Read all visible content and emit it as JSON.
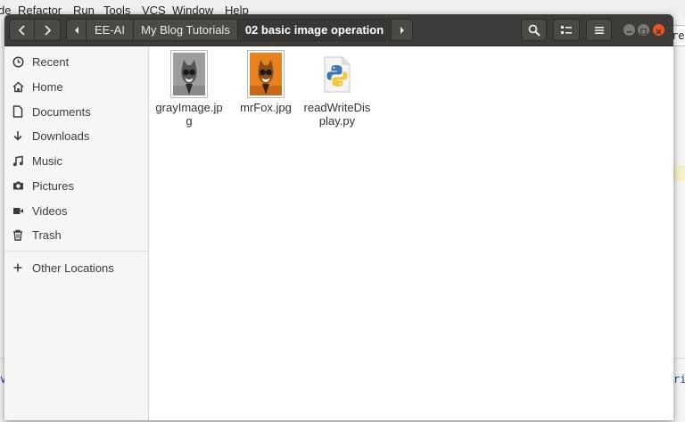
{
  "ide": {
    "menu": [
      "de",
      "Refactor",
      "Run",
      "Tools",
      "VCS",
      "Window",
      "Help"
    ],
    "right_field_text": "rea",
    "fragment_left": "v",
    "fragment_right": "ri"
  },
  "header": {
    "back_icon": "chevron-left-icon",
    "forward_icon": "chevron-right-icon",
    "path_left_arrow": "chevron-left-icon",
    "path_right_arrow": "chevron-right-icon",
    "path": [
      "EE-AI",
      "My Blog Tutorials",
      "02 basic image operation"
    ],
    "search_icon": "search-icon",
    "view_icon": "view-options-icon",
    "menu_icon": "hamburger-menu-icon",
    "window_controls": [
      "minimize-icon",
      "maximize-icon",
      "close-icon"
    ]
  },
  "sidebar": {
    "items": [
      {
        "label": "Recent",
        "icon": "clock-icon"
      },
      {
        "label": "Home",
        "icon": "home-icon"
      },
      {
        "label": "Documents",
        "icon": "document-icon"
      },
      {
        "label": "Downloads",
        "icon": "download-icon"
      },
      {
        "label": "Music",
        "icon": "music-icon"
      },
      {
        "label": "Pictures",
        "icon": "camera-icon"
      },
      {
        "label": "Videos",
        "icon": "video-icon"
      },
      {
        "label": "Trash",
        "icon": "trash-icon"
      }
    ],
    "other": {
      "label": "Other Locations",
      "icon": "plus-icon"
    }
  },
  "files": [
    {
      "name": "grayImage.jpg",
      "display": "grayImage.\njpg",
      "kind": "image-gray"
    },
    {
      "name": "mrFox.jpg",
      "display": "mrFox.jpg",
      "kind": "image-orange"
    },
    {
      "name": "readWriteDisplay.py",
      "display": "readWriteD\nisplay.py",
      "kind": "python"
    }
  ],
  "colors": {
    "headerbar": "#3d3c38",
    "close": "#e95420",
    "sidebar": "#f6f6f5",
    "orange_thumb": "#e8821e"
  }
}
